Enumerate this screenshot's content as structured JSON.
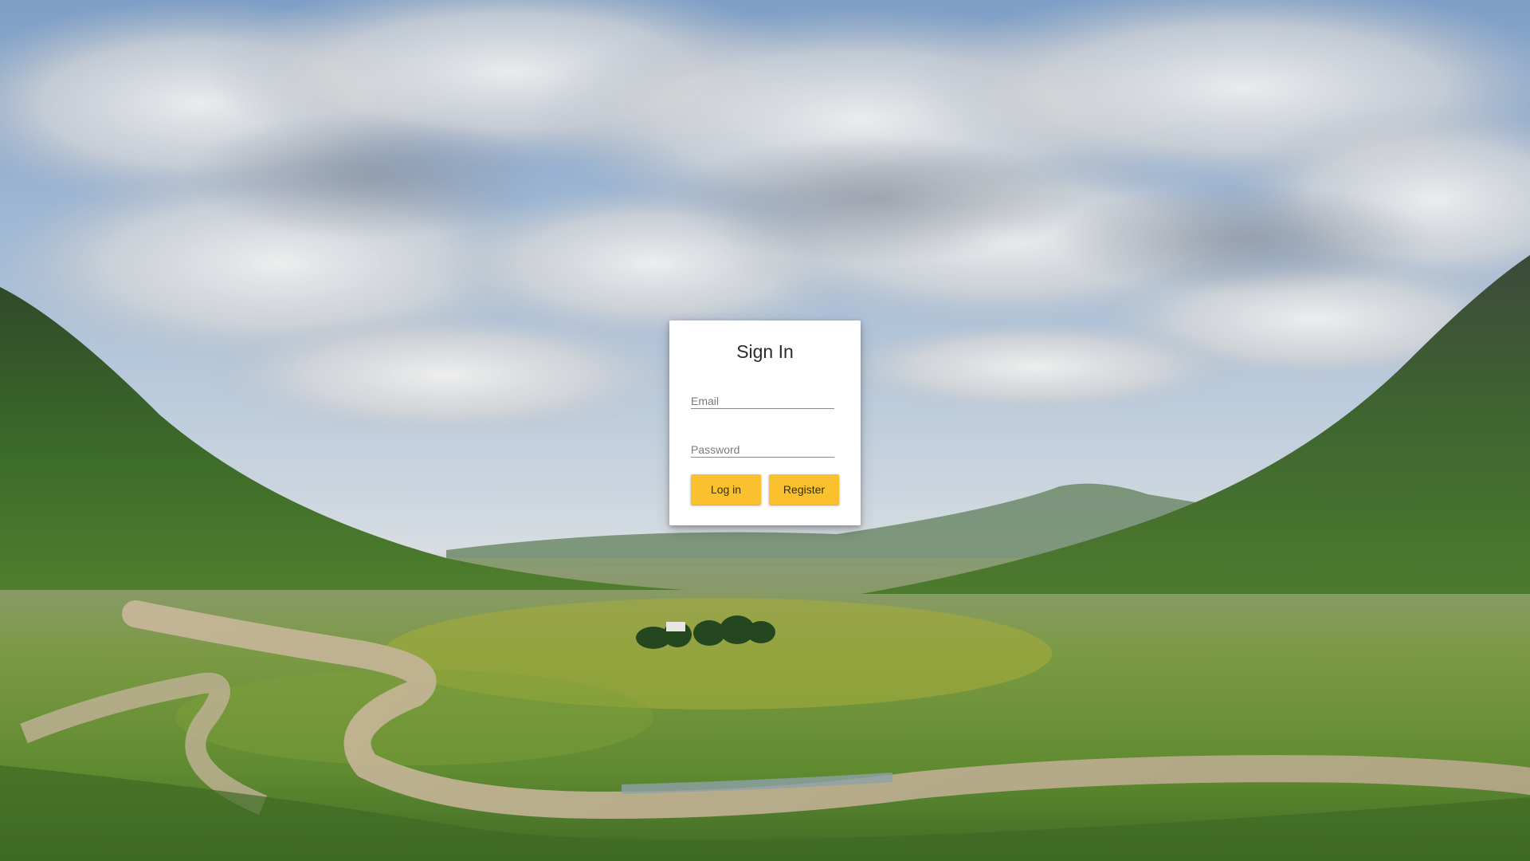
{
  "signin": {
    "title": "Sign In",
    "email_placeholder": "Email",
    "password_placeholder": "Password",
    "login_label": "Log in",
    "register_label": "Register"
  },
  "colors": {
    "button": "#fbc02d",
    "card": "#ffffff"
  }
}
